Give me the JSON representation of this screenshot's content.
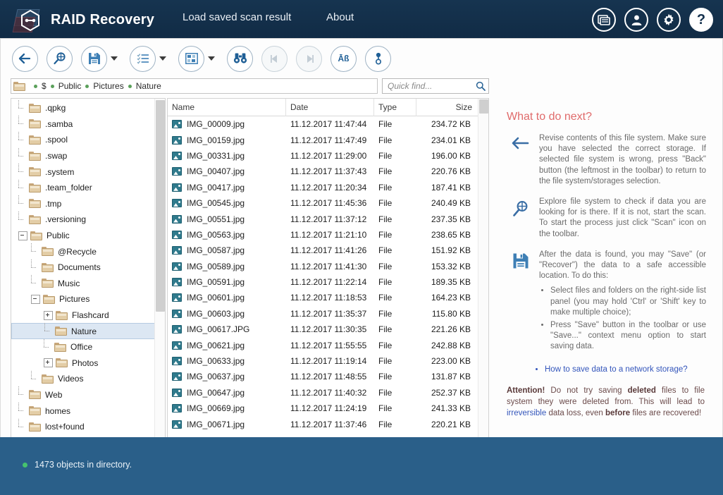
{
  "header": {
    "app_title": "RAID Recovery",
    "logo_icon": "raid-hex-logo",
    "links": [
      {
        "id": "load",
        "label": "Load saved scan result"
      },
      {
        "id": "about",
        "label": "About"
      }
    ],
    "icons": [
      {
        "name": "feedback-icon",
        "glyph": "☰"
      },
      {
        "name": "user-icon",
        "glyph": "👤"
      },
      {
        "name": "gear-icon",
        "glyph": "⚙"
      },
      {
        "name": "help-icon",
        "glyph": "?"
      }
    ]
  },
  "toolbar": {
    "buttons": [
      {
        "name": "back-button",
        "icon": "arrow-left-icon",
        "enabled": true,
        "dropdown": false
      },
      {
        "name": "scan-button",
        "icon": "magnifier-scan-icon",
        "enabled": true,
        "dropdown": false
      },
      {
        "name": "save-button",
        "icon": "floppy-save-icon",
        "enabled": true,
        "dropdown": true
      },
      {
        "name": "list-view-button",
        "icon": "list-lines-icon",
        "enabled": true,
        "dropdown": true
      },
      {
        "name": "tile-view-button",
        "icon": "grid-tiles-icon",
        "enabled": true,
        "dropdown": true
      },
      {
        "name": "find-button",
        "icon": "binoculars-icon",
        "enabled": true,
        "dropdown": false
      },
      {
        "name": "find-previous-button",
        "icon": "step-back-icon",
        "enabled": false,
        "dropdown": false
      },
      {
        "name": "find-next-button",
        "icon": "step-forward-icon",
        "enabled": false,
        "dropdown": false
      },
      {
        "name": "encoding-button",
        "icon": "ab-characters-icon",
        "enabled": true,
        "dropdown": false
      },
      {
        "name": "account-button",
        "icon": "person-pin-icon",
        "enabled": true,
        "dropdown": false
      }
    ]
  },
  "breadcrumb": {
    "folder_icon": "folder-icon",
    "items": [
      "$",
      "Public",
      "Pictures",
      "Nature"
    ]
  },
  "search": {
    "placeholder": "Quick find...",
    "value": "",
    "icon": "search-icon"
  },
  "tree": {
    "items": [
      {
        "label": ".qpkg",
        "indent": 1,
        "state": "leaf"
      },
      {
        "label": ".samba",
        "indent": 1,
        "state": "leaf"
      },
      {
        "label": ".spool",
        "indent": 1,
        "state": "leaf"
      },
      {
        "label": ".swap",
        "indent": 1,
        "state": "leaf"
      },
      {
        "label": ".system",
        "indent": 1,
        "state": "leaf"
      },
      {
        "label": ".team_folder",
        "indent": 1,
        "state": "leaf"
      },
      {
        "label": ".tmp",
        "indent": 1,
        "state": "leaf"
      },
      {
        "label": ".versioning",
        "indent": 1,
        "state": "leaf"
      },
      {
        "label": "Public",
        "indent": 1,
        "state": "expanded"
      },
      {
        "label": "@Recycle",
        "indent": 2,
        "state": "leaf"
      },
      {
        "label": "Documents",
        "indent": 2,
        "state": "leaf"
      },
      {
        "label": "Music",
        "indent": 2,
        "state": "leaf"
      },
      {
        "label": "Pictures",
        "indent": 2,
        "state": "expanded"
      },
      {
        "label": "Flashcard",
        "indent": 3,
        "state": "collapsed"
      },
      {
        "label": "Nature",
        "indent": 3,
        "state": "leaf",
        "selected": true
      },
      {
        "label": "Office",
        "indent": 3,
        "state": "leaf"
      },
      {
        "label": "Photos",
        "indent": 3,
        "state": "collapsed"
      },
      {
        "label": "Videos",
        "indent": 2,
        "state": "leaf"
      },
      {
        "label": "Web",
        "indent": 1,
        "state": "leaf"
      },
      {
        "label": "homes",
        "indent": 1,
        "state": "leaf"
      },
      {
        "label": "lost+found",
        "indent": 1,
        "state": "leaf"
      }
    ]
  },
  "file_list": {
    "columns": [
      "Name",
      "Date",
      "Type",
      "Size"
    ],
    "rows": [
      {
        "name": "IMG_00009.jpg",
        "date": "11.12.2017 11:47:44",
        "type": "File",
        "size": "234.72 KB"
      },
      {
        "name": "IMG_00159.jpg",
        "date": "11.12.2017 11:47:49",
        "type": "File",
        "size": "234.01 KB"
      },
      {
        "name": "IMG_00331.jpg",
        "date": "11.12.2017 11:29:00",
        "type": "File",
        "size": "196.00 KB"
      },
      {
        "name": "IMG_00407.jpg",
        "date": "11.12.2017 11:37:43",
        "type": "File",
        "size": "220.76 KB"
      },
      {
        "name": "IMG_00417.jpg",
        "date": "11.12.2017 11:20:34",
        "type": "File",
        "size": "187.41 KB"
      },
      {
        "name": "IMG_00545.jpg",
        "date": "11.12.2017 11:45:36",
        "type": "File",
        "size": "240.49 KB"
      },
      {
        "name": "IMG_00551.jpg",
        "date": "11.12.2017 11:37:12",
        "type": "File",
        "size": "237.35 KB"
      },
      {
        "name": "IMG_00563.jpg",
        "date": "11.12.2017 11:21:10",
        "type": "File",
        "size": "238.65 KB"
      },
      {
        "name": "IMG_00587.jpg",
        "date": "11.12.2017 11:41:26",
        "type": "File",
        "size": "151.92 KB"
      },
      {
        "name": "IMG_00589.jpg",
        "date": "11.12.2017 11:41:30",
        "type": "File",
        "size": "153.32 KB"
      },
      {
        "name": "IMG_00591.jpg",
        "date": "11.12.2017 11:22:14",
        "type": "File",
        "size": "189.35 KB"
      },
      {
        "name": "IMG_00601.jpg",
        "date": "11.12.2017 11:18:53",
        "type": "File",
        "size": "164.23 KB"
      },
      {
        "name": "IMG_00603.jpg",
        "date": "11.12.2017 11:35:37",
        "type": "File",
        "size": "115.80 KB"
      },
      {
        "name": "IMG_00617.JPG",
        "date": "11.12.2017 11:30:35",
        "type": "File",
        "size": "221.26 KB"
      },
      {
        "name": "IMG_00621.jpg",
        "date": "11.12.2017 11:55:55",
        "type": "File",
        "size": "242.88 KB"
      },
      {
        "name": "IMG_00633.jpg",
        "date": "11.12.2017 11:19:14",
        "type": "File",
        "size": "223.00 KB"
      },
      {
        "name": "IMG_00637.jpg",
        "date": "11.12.2017 11:48:55",
        "type": "File",
        "size": "131.87 KB"
      },
      {
        "name": "IMG_00647.jpg",
        "date": "11.12.2017 11:40:32",
        "type": "File",
        "size": "252.37 KB"
      },
      {
        "name": "IMG_00669.jpg",
        "date": "11.12.2017 11:24:19",
        "type": "File",
        "size": "241.33 KB"
      },
      {
        "name": "IMG_00671.jpg",
        "date": "11.12.2017 11:37:46",
        "type": "File",
        "size": "220.21 KB"
      }
    ]
  },
  "help": {
    "title": "What to do next?",
    "blocks": [
      {
        "icon": "arrow-left-icon",
        "text": "Revise contents of this file system. Make sure you have selected the correct storage. If selected file system is wrong, press \"Back\" button (the leftmost in the toolbar) to return to the file system/storages selection."
      },
      {
        "icon": "magnifier-scan-icon",
        "text": "Explore file system to check if data you are looking for is there. If it is not, start the scan. To start the process just click \"Scan\" icon on the toolbar."
      },
      {
        "icon": "floppy-save-icon",
        "text": "After the data is found, you may \"Save\" (or \"Recover\") the data to a safe accessible location. To do this:",
        "bullets": [
          "Select files and folders on the right-side list panel (you may hold 'Ctrl' or 'Shift' key to make multiple choice);",
          "Press \"Save\" button in the toolbar or use \"Save...\" context menu option to start saving data."
        ]
      }
    ],
    "link": "How to save data to a network storage?",
    "attention": {
      "lead": "Attention!",
      "part1": " Do not try saving ",
      "bold1": "deleted",
      "part2": " files to file system they were deleted from. This will lead to ",
      "highlight": "irreversible",
      "part3": " data loss, even ",
      "bold2": "before",
      "part4": " files are recovered!"
    }
  },
  "status": {
    "text": "1473 objects in directory.",
    "dot_color": "#46c26e"
  },
  "colors": {
    "header_bg": "#13304d",
    "status_bg": "#2a5f89",
    "accent_blue": "#2a6496",
    "help_title": "#e06b6b",
    "link": "#3355bb",
    "selection": "#dce7f3"
  }
}
